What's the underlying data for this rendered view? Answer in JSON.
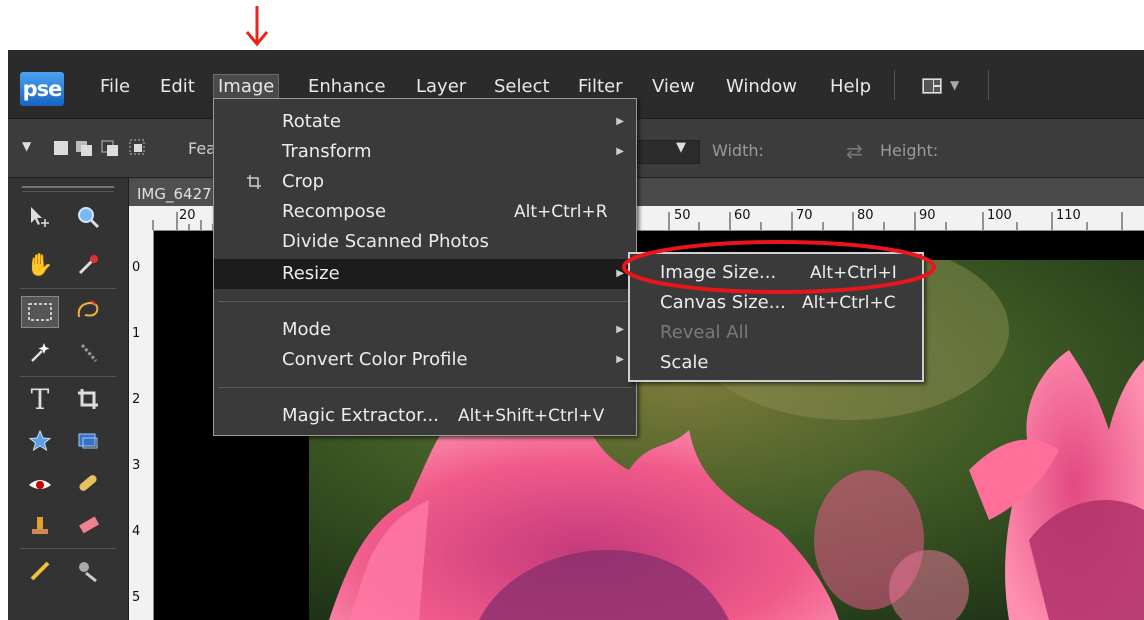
{
  "menubar": {
    "logo": "pse",
    "items": [
      "File",
      "Edit",
      "Image",
      "Enhance",
      "Layer",
      "Select",
      "Filter",
      "View",
      "Window",
      "Help"
    ]
  },
  "options_bar": {
    "feather_label": "Fea",
    "width_label": "Width:",
    "height_label": "Height:"
  },
  "document": {
    "tab_title": "IMG_6427",
    "ruler_h": [
      "20",
      "50",
      "60",
      "70",
      "80",
      "90",
      "100",
      "110"
    ],
    "ruler_v": [
      "0",
      "1",
      "2",
      "3",
      "4",
      "5"
    ]
  },
  "image_menu": {
    "items": [
      {
        "label": "Rotate",
        "shortcut": "",
        "submenu": true
      },
      {
        "label": "Transform",
        "shortcut": "",
        "submenu": true
      },
      {
        "label": "Crop",
        "shortcut": "",
        "submenu": false,
        "icon": "crop-icon"
      },
      {
        "label": "Recompose",
        "shortcut": "Alt+Ctrl+R",
        "submenu": false
      },
      {
        "label": "Divide Scanned Photos",
        "shortcut": "",
        "submenu": false
      },
      {
        "label": "Resize",
        "shortcut": "",
        "submenu": true,
        "highlighted": true
      },
      {
        "label": "Mode",
        "shortcut": "",
        "submenu": true
      },
      {
        "label": "Convert Color Profile",
        "shortcut": "",
        "submenu": true
      },
      {
        "label": "Magic Extractor...",
        "shortcut": "Alt+Shift+Ctrl+V",
        "submenu": false
      }
    ]
  },
  "resize_submenu": {
    "items": [
      {
        "label": "Image Size...",
        "shortcut": "Alt+Ctrl+I"
      },
      {
        "label": "Canvas Size...",
        "shortcut": "Alt+Ctrl+C"
      },
      {
        "label": "Reveal All",
        "shortcut": "",
        "disabled": true
      },
      {
        "label": "Scale",
        "shortcut": ""
      }
    ]
  },
  "annotation_colors": {
    "arrow": "#e8261e",
    "oval": "#e8151a"
  },
  "theme": {
    "menu_bg": "#3a3a3a",
    "highlight": "#1c1c1c",
    "menubar_bg": "#2b2b2b"
  }
}
